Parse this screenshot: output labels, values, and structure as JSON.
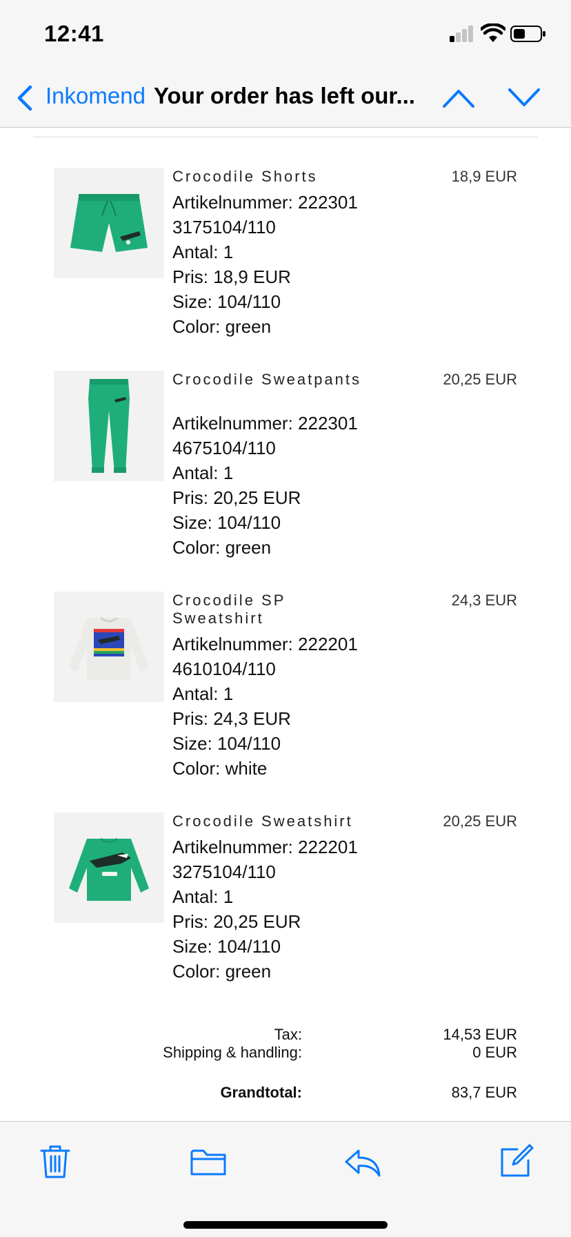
{
  "status_bar": {
    "time": "12:41"
  },
  "nav": {
    "back_label": "Inkomend",
    "title": "Your order has left our..."
  },
  "items": [
    {
      "name": "Crocodile Shorts",
      "price": "18,9 EUR",
      "details": [
        "Artikelnummer: 222301",
        "3175104/110",
        "Antal: 1",
        "Pris:  18,9 EUR",
        "Size: 104/110",
        "Color: green"
      ],
      "image": "green-shorts"
    },
    {
      "name": "Crocodile Sweatpants",
      "price": "20,25 EUR",
      "details": [
        "Artikelnummer: 222301",
        "4675104/110",
        "Antal: 1",
        "Pris:  20,25 EUR",
        "Size: 104/110",
        "Color: green"
      ],
      "image": "green-sweatpants"
    },
    {
      "name": "Crocodile SP Sweatshirt",
      "price": "24,3 EUR",
      "details": [
        "Artikelnummer: 222201",
        "4610104/110",
        "Antal: 1",
        "Pris:  24,3 EUR",
        "Size: 104/110",
        "Color: white"
      ],
      "image": "white-sweatshirt"
    },
    {
      "name": "Crocodile Sweatshirt",
      "price": "20,25 EUR",
      "details": [
        "Artikelnummer: 222201",
        "3275104/110",
        "Antal: 1",
        "Pris:  20,25 EUR",
        "Size: 104/110",
        "Color: green"
      ],
      "image": "green-sweatshirt"
    }
  ],
  "totals": {
    "tax_label": "Tax:",
    "tax_value": "14,53 EUR",
    "shipping_label": "Shipping & handling:",
    "shipping_value": "0 EUR",
    "grandtotal_label": "Grandtotal:",
    "grandtotal_value": "83,7 EUR"
  },
  "toolbar": {
    "icons": [
      "trash-icon",
      "folder-icon",
      "reply-icon",
      "compose-icon"
    ]
  },
  "colors": {
    "accent": "#0a7aff",
    "product_green": "#1fae7a",
    "bar_background": "#f6f6f6"
  }
}
